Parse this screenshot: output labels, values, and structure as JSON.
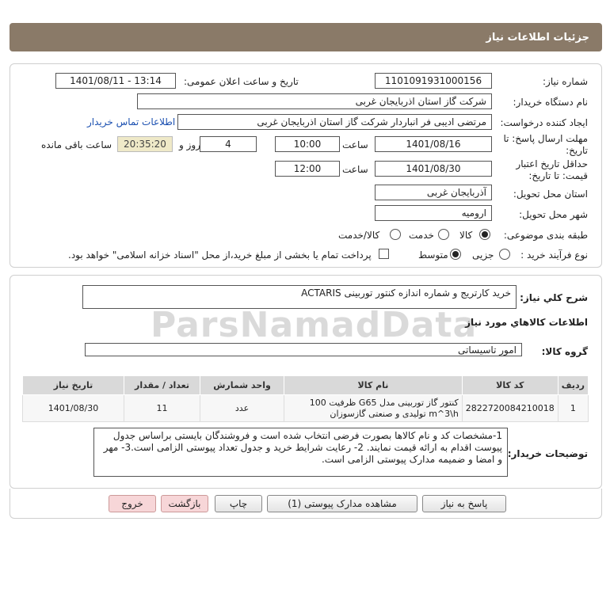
{
  "header": {
    "title": "جزئیات اطلاعات نیاز"
  },
  "form": {
    "need_number_label": "شماره نیاز:",
    "need_number": "1101091931000156",
    "announce_label": "تاریخ و ساعت اعلان عمومی:",
    "announce_value": "1401/08/11 - 13:14",
    "buyer_org_label": "نام دستگاه خریدار:",
    "buyer_org": "شرکت گاز استان اذربایجان غربی",
    "creator_label": "ایجاد کننده درخواست:",
    "creator": "مرتضی ادیبی فر انباردار شرکت گاز استان اذربایجان غربی",
    "contact_link": "اطلاعات تماس خریدار",
    "deadline_label_1": "مهلت ارسال پاسخ: تا",
    "deadline_label_2": "تاریخ:",
    "deadline_date": "1401/08/16",
    "time_label": "ساعت",
    "deadline_time": "10:00",
    "days_value": "4",
    "days_label": "روز و",
    "remaining_time": "20:35:20",
    "remaining_label": "ساعت باقی مانده",
    "validity_label_1": "حداقل تاریخ اعتبار",
    "validity_label_2": "قیمت: تا تاریخ:",
    "validity_date": "1401/08/30",
    "validity_time_label": "ساعت",
    "validity_time": "12:00",
    "province_label": "استان محل تحویل:",
    "province": "آذربایجان غربی",
    "city_label": "شهر محل تحویل:",
    "city": "ارومیه",
    "category_label": "طبقه بندی موضوعی:",
    "category_options": [
      "کالا",
      "خدمت",
      "کالا/خدمت"
    ],
    "process_label": "نوع فرآیند خرید :",
    "process_options": [
      "جزیی",
      "متوسط"
    ],
    "payment_note": "پرداخت تمام یا بخشی از مبلغ خرید،از محل \"اسناد خزانه اسلامی\" خواهد بود."
  },
  "summary": {
    "label": "شرح کلي نیاز:",
    "value": "خرید  کارتریج و شماره انداز‌ه کنتور توربینی ACTARIS"
  },
  "goods_info": {
    "heading": "اطلاعات کالاهاي مورد نياز",
    "group_label": "گروه کالا:",
    "group_value": "امور تاسیساتی"
  },
  "table": {
    "headers": [
      "ردیف",
      "کد کالا",
      "نام کالا",
      "واحد شمارش",
      "تعداد / مقدار",
      "تاریخ نیاز"
    ],
    "rows": [
      {
        "row": "1",
        "code": "2822720084210018",
        "name": "کنتور گاز توربینی مدل G65 ظرفیت 100 m^3\\h تولیدی و صنعتی گازسوزان",
        "unit": "عدد",
        "qty": "11",
        "date": "1401/08/30"
      }
    ]
  },
  "notes": {
    "label": "توضیحات خریدار:",
    "text": "1-مشخصات کد و نام کالاها بصورت فرضی انتخاب شده است و فروشندگان بایستی براساس جدول پیوست اقدام به ارائه قیمت نمایند. 2- رعایت شرایط خرید و جدول تعداد پیوستی الزامی است.3- مهر و امضا و ضمیمه مدارک پیوستی الزامی است."
  },
  "buttons": {
    "reply": "پاسخ به نیاز",
    "view_docs": "مشاهده مدارک پیوستی (1)",
    "print": "چاپ",
    "back": "بازگشت",
    "exit": "خروج"
  },
  "watermark": {
    "text": "ParsNamadData"
  }
}
